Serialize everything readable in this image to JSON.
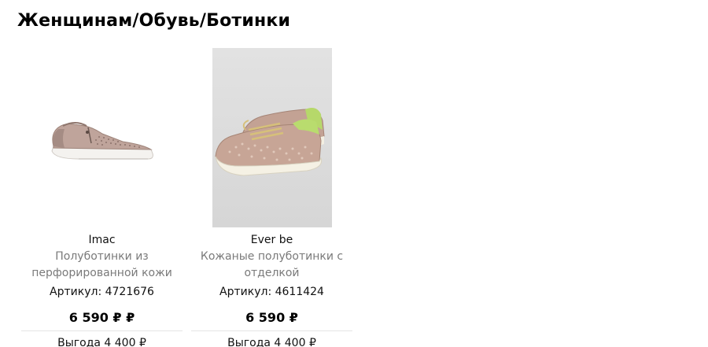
{
  "breadcrumb": "Женщинам/Обувь/Ботинки",
  "products": [
    {
      "brand": "Imac",
      "description": "Полуботинки из перфорированной кожи",
      "sku": "Артикул: 4721676",
      "price": "6 590 ₽ ₽",
      "savings": "Выгода 4 400 ₽",
      "image": "sneaker-side-view"
    },
    {
      "brand": "Ever be",
      "description": "Кожаные полуботинки с отделкой",
      "sku": "Артикул: 4611424",
      "price": "6 590 ₽",
      "savings": "Выгода 4 400 ₽",
      "image": "sneaker-pair-photo"
    }
  ]
}
